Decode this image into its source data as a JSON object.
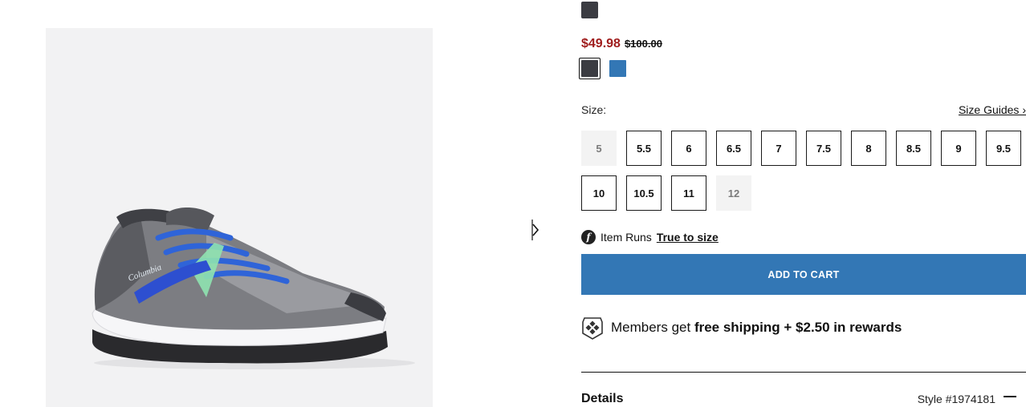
{
  "product": {
    "image_alt": "Grey and blue trail running shoe",
    "brand_mark": "Columbia"
  },
  "price": {
    "sale": "$49.98",
    "original": "$100.00",
    "sale_color": "#9f1c1c"
  },
  "colors": {
    "top_swatch": "#3b3c42",
    "swatches": [
      {
        "color": "#3b3c42",
        "selected": true
      },
      {
        "color": "#3377b5",
        "selected": false
      }
    ]
  },
  "size": {
    "label": "Size:",
    "guides_link": "Size Guides ›",
    "options": [
      {
        "label": "5",
        "available": false
      },
      {
        "label": "5.5",
        "available": true
      },
      {
        "label": "6",
        "available": true
      },
      {
        "label": "6.5",
        "available": true
      },
      {
        "label": "7",
        "available": true
      },
      {
        "label": "7.5",
        "available": true
      },
      {
        "label": "8",
        "available": true
      },
      {
        "label": "8.5",
        "available": true
      },
      {
        "label": "9",
        "available": true
      },
      {
        "label": "9.5",
        "available": true
      },
      {
        "label": "10",
        "available": true
      },
      {
        "label": "10.5",
        "available": true
      },
      {
        "label": "11",
        "available": true
      },
      {
        "label": "12",
        "available": false
      }
    ]
  },
  "fit": {
    "icon": "f",
    "prefix": "Item Runs",
    "value": "True to size"
  },
  "cart": {
    "button_label": "ADD TO CART",
    "accent": "#3377b5"
  },
  "members": {
    "prefix": "Members get",
    "highlight": "free shipping + $2.50 in rewards",
    "icon": "rewards-badge-icon"
  },
  "details": {
    "title": "Details",
    "style": "Style #1974181"
  }
}
